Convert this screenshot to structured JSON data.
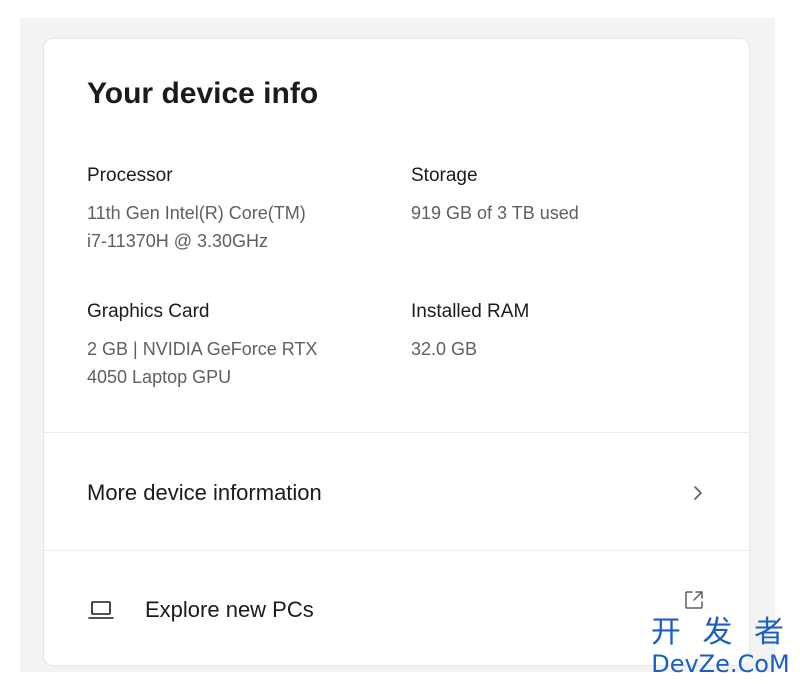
{
  "card": {
    "title": "Your device info",
    "specs": {
      "processor": {
        "label": "Processor",
        "value": "11th Gen Intel(R) Core(TM)\ni7-11370H @ 3.30GHz"
      },
      "storage": {
        "label": "Storage",
        "value": "919 GB of 3 TB used"
      },
      "graphics": {
        "label": "Graphics Card",
        "value": "2 GB | NVIDIA GeForce RTX\n4050 Laptop GPU"
      },
      "ram": {
        "label": "Installed RAM",
        "value": "32.0 GB"
      }
    },
    "links": {
      "more_info": {
        "label": "More device information",
        "icon": "chevron-right-icon"
      },
      "explore": {
        "label": "Explore new PCs",
        "icon": "laptop-icon",
        "trailing_icon": "external-link-icon"
      }
    }
  },
  "watermark": {
    "line1": "开 发 者",
    "line2": "DevZe.CoM"
  },
  "colors": {
    "background": "#f3f3f3",
    "card": "#ffffff",
    "primary_text": "#1b1b1b",
    "secondary_text": "#5f5f5f",
    "watermark": "#1a5fc1"
  }
}
